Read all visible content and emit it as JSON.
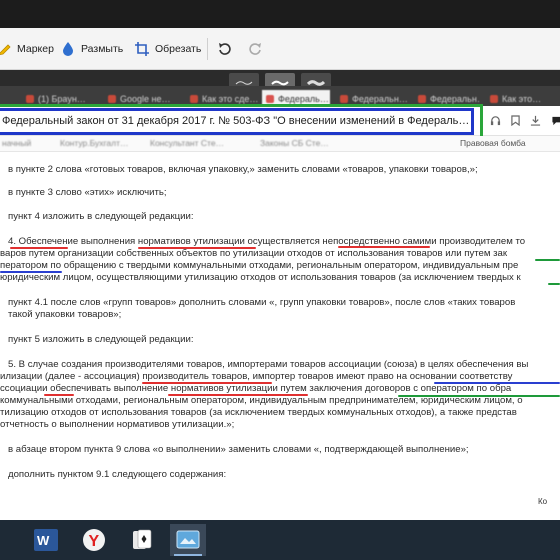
{
  "editor": {
    "tools": [
      {
        "label": "Маркер",
        "icon": "marker-icon"
      },
      {
        "label": "Размыть",
        "icon": "blur-drop-icon"
      },
      {
        "label": "Обрезать",
        "icon": "crop-icon"
      }
    ],
    "undo_icon": "undo-icon",
    "redo_icon": "redo-icon",
    "stroke_widths": [
      "thin",
      "medium",
      "thick"
    ],
    "active_stroke": "medium"
  },
  "browser": {
    "tabs": [
      "(1) Браун…",
      "Google не…",
      "Как это сде…",
      "Федераль…",
      "Федеральн…",
      "Федеральн…",
      "Как это…"
    ],
    "active_tab_index": 3,
    "address_text": "Федеральный закон от 31 декабря 2017 г. № 503-ФЗ \"О внесении изменений в Федераль…",
    "bookmarks": [
      "начный",
      "Контур.Бухгалт…",
      "Консультант Сте…",
      "Законы СБ Сте…",
      "Правовая бомба"
    ]
  },
  "document": {
    "lines": [
      "в пункте 2 слова «готовых товаров, включая упаковку,» заменить словами «товаров, упаковки товаров,»;",
      "в пункте 3 слово «этих» исключить;",
      "пункт 4 изложить в следующей редакции:",
      "4. Обеспечение выполнения нормативов утилизации осуществляется непосредственно самими производителем то",
      "варов путем организации собственных объектов по утилизации отходов от использования товаров или путем зак",
      "ператором по обращению с твердыми коммунальными отходами, региональным оператором, индивидуальным пре",
      "юридическим лицом, осуществляющими утилизацию отходов от использования товаров (за исключением твердых к",
      "пункт 4.1 после слов «групп товаров» дополнить словами «, групп упаковки товаров», после слов «таких товаров",
      "такой упаковки товаров»;",
      "пункт 5 изложить в следующей редакции:",
      "5. В случае создания производителями товаров, импортерами товаров ассоциации (союза) в целях обеспечения вы",
      "илизации (далее - ассоциация) производитель товаров, импортер товаров имеют право на основании соответству",
      "ссоциации обеспечивать выполнение нормативов утилизации путем заключения договоров с оператором по обра",
      "коммунальными отходами, региональным оператором, индивидуальным предпринимателем, юридическим лицом, о",
      "тилизацию отходов от использования товаров (за исключением твердых коммунальных отходов), а также представ",
      "отчетность о выполнении нормативов утилизации.»;",
      "в абзаце втором пункта 9 слова «о выполнении» заменить словами «, подтверждающей выполнение»;",
      "дополнить пунктом 9.1 следующего содержания:"
    ],
    "side_panel_label": "Ко"
  },
  "taskbar": {
    "apps": [
      "Word",
      "Yandex Browser",
      "Solitaire",
      "Screenshot Tool"
    ]
  },
  "colors": {
    "marker_red": "#e03030",
    "marker_green": "#1e9a3a",
    "marker_blue": "#2a3fd0",
    "frame_blue": "#1f37c9",
    "frame_green": "#2aa63a"
  }
}
